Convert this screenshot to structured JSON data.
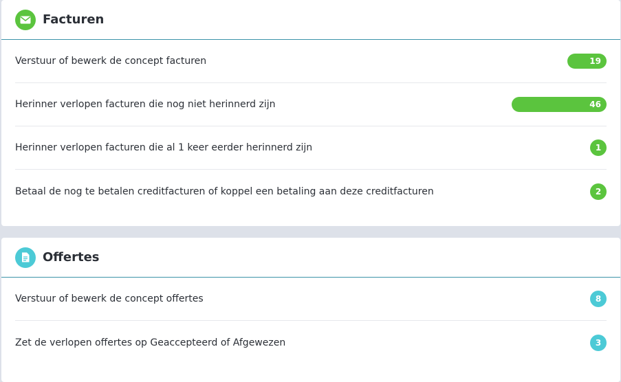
{
  "colors": {
    "green": "#5bc43e",
    "teal": "#4ccad6",
    "header_rule": "#3b93a8"
  },
  "facturen": {
    "title": "Facturen",
    "icon": "envelope-icon",
    "items": [
      {
        "label": "Verstuur of bewerk de concept facturen",
        "count": "19",
        "style": "bar"
      },
      {
        "label": "Herinner verlopen facturen die nog niet herinnerd zijn",
        "count": "46",
        "style": "bar"
      },
      {
        "label": "Herinner verlopen facturen die al 1 keer eerder herinnerd zijn",
        "count": "1",
        "style": "circle"
      },
      {
        "label": "Betaal de nog te betalen creditfacturen of koppel een betaling aan deze creditfacturen",
        "count": "2",
        "style": "circle"
      }
    ]
  },
  "offertes": {
    "title": "Offertes",
    "icon": "document-icon",
    "items": [
      {
        "label": "Verstuur of bewerk de concept offertes",
        "count": "8",
        "style": "circle"
      },
      {
        "label": "Zet de verlopen offertes op Geaccepteerd of Afgewezen",
        "count": "3",
        "style": "circle"
      }
    ]
  }
}
